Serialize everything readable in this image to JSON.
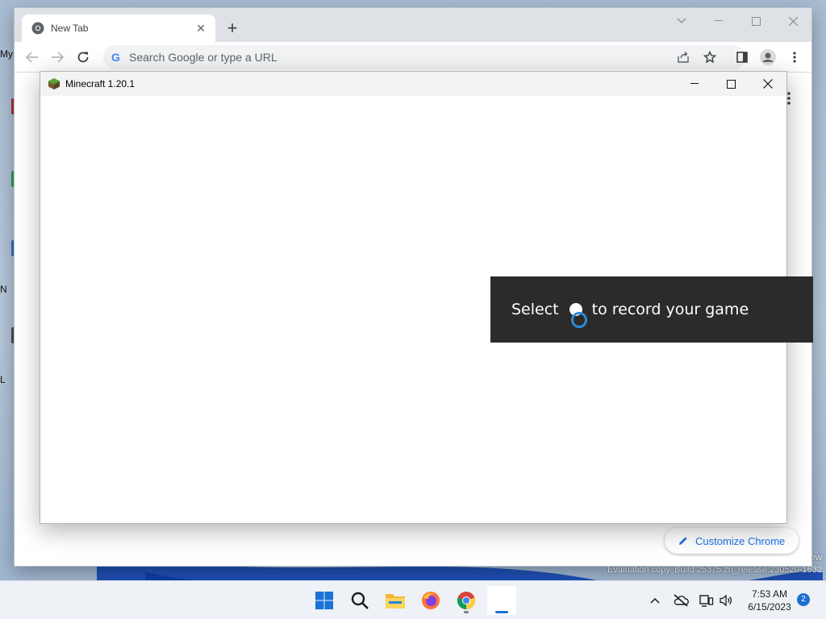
{
  "desktop": {
    "side_labels": [
      "My",
      "N",
      "L"
    ],
    "watermark_line1": "ew",
    "watermark_line2": "Evaluation copy. Build 25375.zn_release.230520-1632"
  },
  "chrome": {
    "tab": {
      "title": "New Tab",
      "favicon": "chrome-icon"
    },
    "omnibox": {
      "placeholder": "Search Google or type a URL",
      "value": ""
    },
    "customize_label": "Customize Chrome"
  },
  "minecraft": {
    "title": "Minecraft 1.20.1",
    "logo": "grass-block-icon"
  },
  "gamebar_toast": {
    "text_before": "Select",
    "text_after": "to record your game"
  },
  "taskbar": {
    "apps": [
      "windows-start-icon",
      "search-icon",
      "file-explorer-icon",
      "firefox-icon",
      "chrome-icon",
      "minecraft-launcher-icon"
    ],
    "time": "7:53 AM",
    "date": "6/15/2023",
    "notification_count": "2"
  },
  "colors": {
    "accent": "#1f6fd1",
    "toast_bg": "#2b2b2b",
    "chrome_link": "#1a73e8"
  }
}
